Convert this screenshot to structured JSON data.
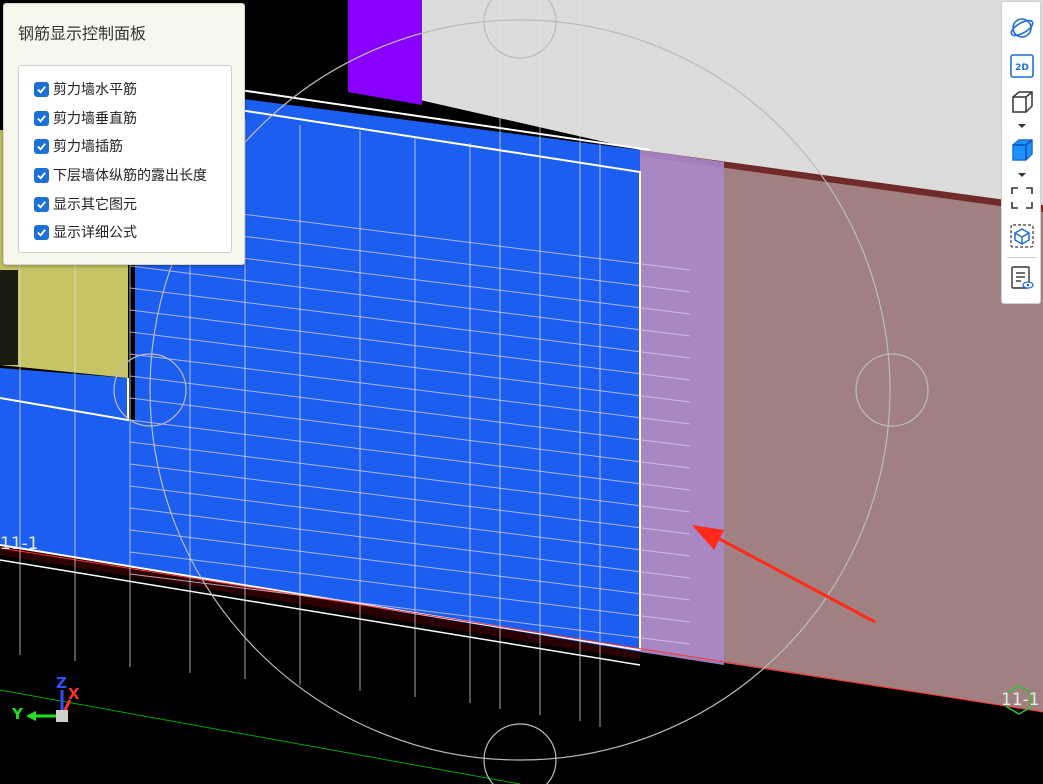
{
  "panel": {
    "title": "钢筋显示控制面板",
    "items": [
      {
        "label": "剪力墙水平筋",
        "checked": true
      },
      {
        "label": "剪力墙垂直筋",
        "checked": true
      },
      {
        "label": "剪力墙插筋",
        "checked": true
      },
      {
        "label": "下层墙体纵筋的露出长度",
        "checked": true
      },
      {
        "label": "显示其它图元",
        "checked": true
      },
      {
        "label": "显示详细公式",
        "checked": true
      }
    ]
  },
  "toolbar": {
    "items": [
      {
        "name": "orbit-view",
        "icon": "orbit-icon"
      },
      {
        "name": "2d-view",
        "icon": "2d-icon",
        "text": "2D"
      },
      {
        "name": "wireframe-cube",
        "icon": "cube-outline-icon"
      },
      {
        "name": "solid-cube",
        "icon": "cube-solid-icon"
      },
      {
        "name": "fit-view",
        "icon": "fit-view-icon"
      },
      {
        "name": "select-view",
        "icon": "select-cube-icon"
      },
      {
        "name": "rebar-report",
        "icon": "report-view-icon"
      }
    ]
  },
  "viewport": {
    "grid_labels": [
      "11-1",
      "11-1"
    ],
    "axis": {
      "x": "X",
      "y": "Y",
      "z": "Z"
    },
    "colors": {
      "wall": "#1b5ef0",
      "wall_dark": "#0a2fb8",
      "purple": "#8a00ff",
      "yellow": "#c6c464",
      "pink": "#a08080",
      "annotation": "#ff2a1a"
    }
  }
}
